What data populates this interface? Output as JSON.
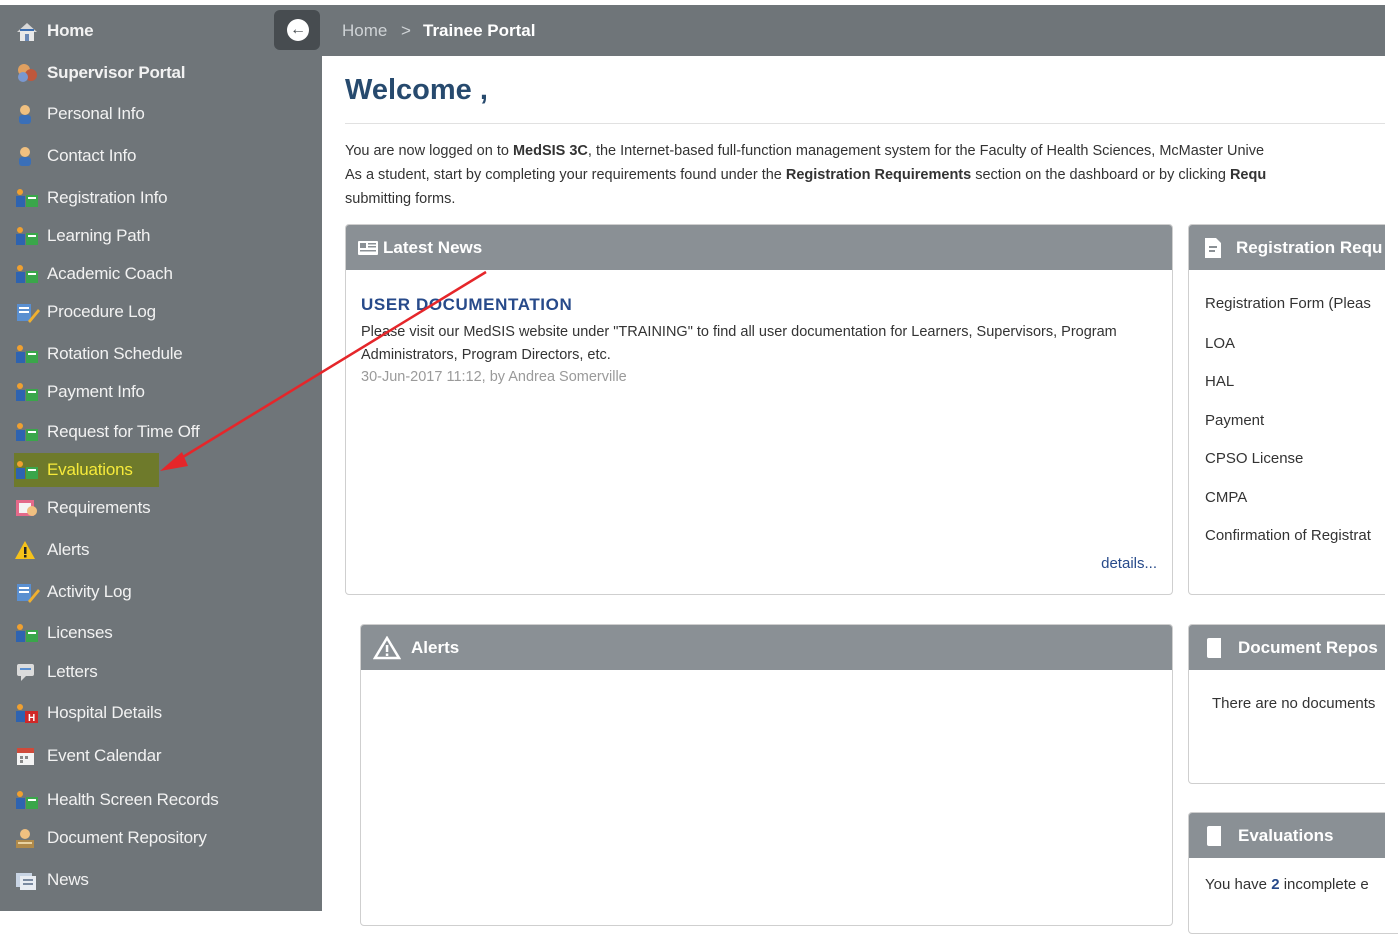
{
  "sidebar": {
    "items": [
      {
        "label": "Home",
        "icon": "home-icon"
      },
      {
        "label": "Supervisor Portal",
        "icon": "supervisor-icon"
      },
      {
        "label": "Personal Info",
        "icon": "person-icon"
      },
      {
        "label": "Contact Info",
        "icon": "person-icon"
      },
      {
        "label": "Registration Info",
        "icon": "users-folder-icon"
      },
      {
        "label": "Learning Path",
        "icon": "users-folder-icon"
      },
      {
        "label": "Academic Coach",
        "icon": "users-folder-icon"
      },
      {
        "label": "Procedure Log",
        "icon": "log-icon"
      },
      {
        "label": "Rotation Schedule",
        "icon": "users-folder-icon"
      },
      {
        "label": "Payment Info",
        "icon": "users-folder-icon"
      },
      {
        "label": "Request for Time Off",
        "icon": "users-folder-icon"
      },
      {
        "label": "Evaluations",
        "icon": "users-folder-icon"
      },
      {
        "label": "Requirements",
        "icon": "requirements-icon"
      },
      {
        "label": "Alerts",
        "icon": "warning-icon"
      },
      {
        "label": "Activity Log",
        "icon": "log-icon"
      },
      {
        "label": "Licenses",
        "icon": "users-folder-icon"
      },
      {
        "label": "Letters",
        "icon": "letter-icon"
      },
      {
        "label": "Hospital Details",
        "icon": "hospital-icon"
      },
      {
        "label": "Event Calendar",
        "icon": "calendar-icon"
      },
      {
        "label": "Health Screen Records",
        "icon": "users-folder-icon"
      },
      {
        "label": "Document Repository",
        "icon": "repository-icon"
      },
      {
        "label": "News",
        "icon": "news-icon"
      }
    ],
    "active_item": "Evaluations"
  },
  "breadcrumb": {
    "home": "Home",
    "separator": ">",
    "current": "Trainee Portal"
  },
  "welcome": {
    "title": "Welcome ,",
    "line1_a": "You are now logged on to ",
    "line1_b": "MedSIS 3C",
    "line1_c": ", the Internet-based full-function management system for the Faculty of Health Sciences, McMaster Unive",
    "line2_a": "As a student, start by completing your requirements found under the ",
    "line2_b": "Registration Requirements",
    "line2_c": " section on the dashboard or by clicking ",
    "line2_d": "Requ",
    "line3": "submitting forms."
  },
  "latest_news": {
    "title": "Latest News",
    "item_title": "USER DOCUMENTATION",
    "item_body": "Please visit our MedSIS website under \"TRAINING\" to find all user documentation for Learners, Supervisors, Program Administrators, Program Directors, etc.",
    "item_meta": "30-Jun-2017 11:12, by Andrea Somerville",
    "details_link": "details..."
  },
  "registration_requirements": {
    "title": "Registration Requ",
    "items": [
      "Registration Form (Pleas",
      "LOA",
      "HAL",
      "Payment",
      "CPSO License",
      "CMPA",
      "Confirmation of Registrat"
    ]
  },
  "alerts_panel": {
    "title": "Alerts"
  },
  "document_repository_panel": {
    "title": "Document Repos",
    "empty_text": "There are no documents"
  },
  "evaluations_panel": {
    "title": "Evaluations",
    "text_a": "You have ",
    "count": "2",
    "text_b": " incomplete e"
  },
  "colors": {
    "sidebar_bg": "#6f7579",
    "panel_header_bg": "#8a9095",
    "title_blue": "#274a6e",
    "link_blue": "#274a8a",
    "highlight_bg": "#6e7a2b",
    "highlight_text": "#f6ea3a",
    "annotation_arrow": "#e5262a"
  }
}
